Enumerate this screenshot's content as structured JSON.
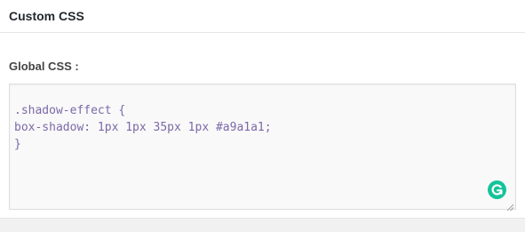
{
  "panel": {
    "title": "Custom CSS"
  },
  "field": {
    "label": "Global CSS :",
    "value": ".shadow-effect {\nbox-shadow: 1px 1px 35px 1px #a9a1a1;\n}"
  },
  "colors": {
    "code_text": "#7b69a8",
    "grammarly_green": "#15c39a"
  },
  "icons": {
    "grammarly": "grammarly-icon",
    "resize": "resize-handle-icon"
  }
}
